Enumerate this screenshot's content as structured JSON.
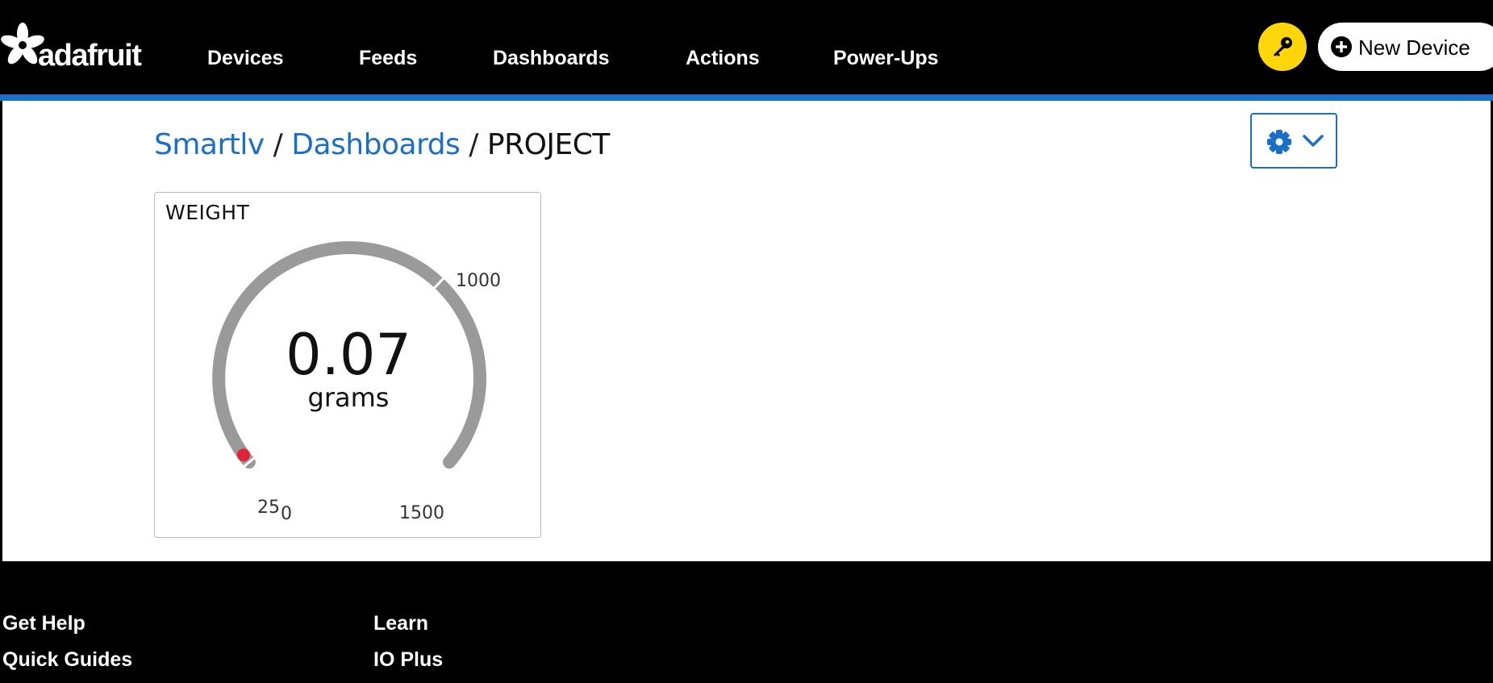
{
  "nav": {
    "brand": "adafruit",
    "links": [
      "Devices",
      "Feeds",
      "Dashboards",
      "Actions",
      "Power-Ups"
    ],
    "new_device_label": "New Device"
  },
  "breadcrumb": {
    "user": "Smartlv",
    "sep1": "/",
    "dashboards": "Dashboards",
    "sep2": "/",
    "current": "PROJECT"
  },
  "gauge_block": {
    "title": "WEIGHT",
    "value": "0.07",
    "unit": "grams",
    "ticks": {
      "min_a": "25",
      "min_b": "0",
      "warn": "1000",
      "max": "1500"
    },
    "min": 0,
    "max": 1500,
    "high_warning": 1000,
    "current": 0.07,
    "colors": {
      "track": "#9a9a9a",
      "indicator": "#e0223b",
      "accent": "#1a6fc9"
    }
  },
  "footer": {
    "get_help": "Get Help",
    "learn": "Learn",
    "quick_guides": "Quick Guides",
    "io_plus": "IO Plus"
  }
}
